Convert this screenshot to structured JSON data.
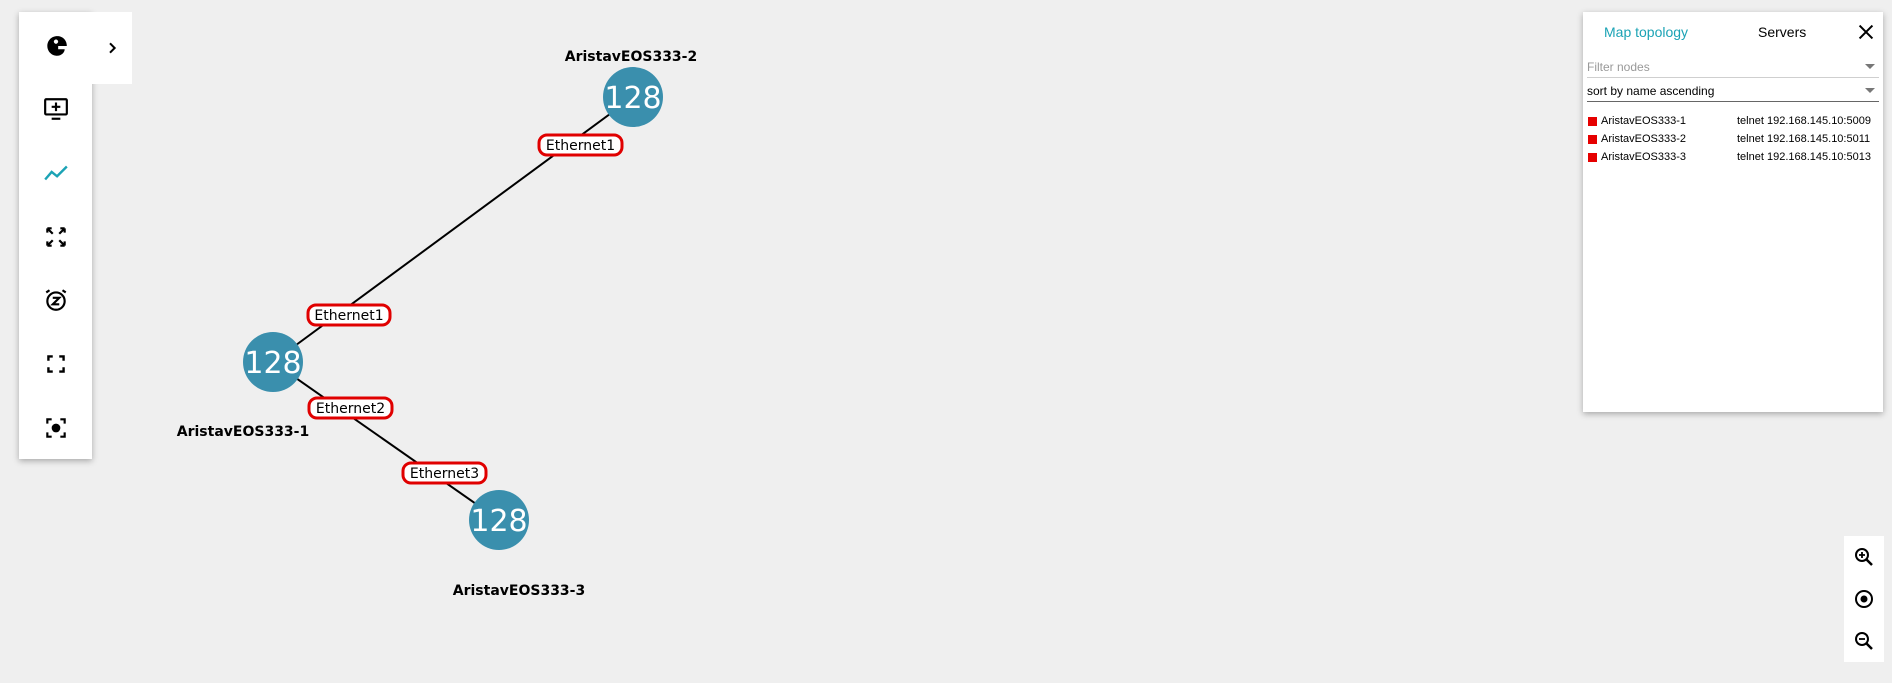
{
  "toolbar": {
    "items": [
      {
        "icon": "gns3-logo-icon"
      },
      {
        "icon": "add-node-monitor-icon"
      },
      {
        "icon": "topology-chart-icon"
      },
      {
        "icon": "fit-to-screen-icon"
      },
      {
        "icon": "snooze-alarm-icon"
      },
      {
        "icon": "fullscreen-icon"
      },
      {
        "icon": "screenshot-capture-icon"
      }
    ],
    "expand_icon": "chevron-right-icon"
  },
  "topology": {
    "nodes": [
      {
        "name": "AristavEOS333-2",
        "badge": "128"
      },
      {
        "name": "AristavEOS333-1",
        "badge": "128"
      },
      {
        "name": "AristavEOS333-3",
        "badge": "128"
      }
    ],
    "links": [
      {
        "a": "AristavEOS333-1",
        "a_iface": "Ethernet1",
        "b": "AristavEOS333-2",
        "b_iface": "Ethernet1"
      },
      {
        "a": "AristavEOS333-1",
        "a_iface": "Ethernet2",
        "b": "AristavEOS333-3",
        "b_iface": "Ethernet3"
      }
    ],
    "colors": {
      "node": "#3a8fad",
      "interface_border": "#e00000",
      "link": "#000000"
    }
  },
  "panel": {
    "tabs": [
      {
        "label": "Map topology",
        "active": true
      },
      {
        "label": "Servers",
        "active": false
      }
    ],
    "filter": {
      "placeholder": "Filter nodes",
      "value": ""
    },
    "sort": {
      "value": "sort by name ascending"
    },
    "nodes": [
      {
        "name": "AristavEOS333-1",
        "console": "telnet 192.168.145.10:5009",
        "status": "stopped"
      },
      {
        "name": "AristavEOS333-2",
        "console": "telnet 192.168.145.10:5011",
        "status": "stopped"
      },
      {
        "name": "AristavEOS333-3",
        "console": "telnet 192.168.145.10:5013",
        "status": "stopped"
      }
    ],
    "accent_color": "#1ba3b5",
    "status_color": "#e60000"
  },
  "zoom_controls": [
    {
      "icon": "zoom-in-icon"
    },
    {
      "icon": "reset-zoom-icon"
    },
    {
      "icon": "zoom-out-icon"
    }
  ]
}
